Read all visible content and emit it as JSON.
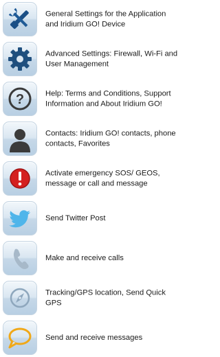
{
  "items": [
    {
      "icon": "settings-wrench-screwdriver-icon",
      "label": "General Settings for the Application\nand Iridium GO! Device"
    },
    {
      "icon": "gear-icon",
      "label": "Advanced Settings: Firewall, Wi-Fi and\nUser Management"
    },
    {
      "icon": "help-question-icon",
      "label": "Help: Terms and Conditions, Support\nInformation and About Iridium GO!"
    },
    {
      "icon": "contact-person-icon",
      "label": "Contacts: Iridium GO! contacts, phone\ncontacts, Favorites"
    },
    {
      "icon": "emergency-alert-icon",
      "label": "Activate emergency SOS/ GEOS,\nmessage or call and message"
    },
    {
      "icon": "twitter-bird-icon",
      "label": "Send Twitter Post"
    },
    {
      "icon": "phone-handset-icon",
      "label": "Make and receive calls"
    },
    {
      "icon": "compass-icon",
      "label": "Tracking/GPS location, Send Quick GPS"
    },
    {
      "icon": "chat-bubble-icon",
      "label": "Send and receive messages"
    }
  ]
}
